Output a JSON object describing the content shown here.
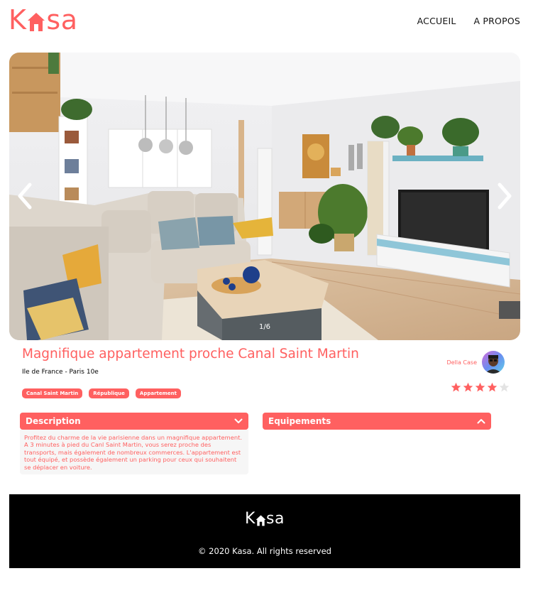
{
  "brand": {
    "logo_k": "K",
    "logo_rest": "sa",
    "color_primary": "#FF6060"
  },
  "nav": {
    "items": [
      {
        "label": "ACCUEIL"
      },
      {
        "label": "A PROPOS"
      }
    ]
  },
  "gallery": {
    "counter": "1/6",
    "current": 1,
    "total": 6
  },
  "listing": {
    "title": "Magnifique appartement proche Canal Saint Martin",
    "location": "Ile de France - Paris 10e",
    "tags": [
      "Canal Saint Martin",
      "République",
      "Appartement"
    ],
    "host_name": "Della Case",
    "rating": 4,
    "rating_max": 5
  },
  "collapses": {
    "description": {
      "title": "Description",
      "text": "Profitez du charme de la vie parisienne dans un magnifique appartement. A 3 minutes à pied du Canl Saint Martin, vous serez proche des transports, mais également de nombreux commerces. L'appartement est tout équipé, et possède également un parking pour ceux qui souhaitent se déplacer en voiture."
    },
    "equipements": {
      "title": "Equipements"
    }
  },
  "footer": {
    "copyright": "© 2020 Kasa. All rights reserved"
  },
  "colors": {
    "accent": "#FF6060",
    "footer_bg": "#000000",
    "panel_bg": "#F6F6F6"
  }
}
